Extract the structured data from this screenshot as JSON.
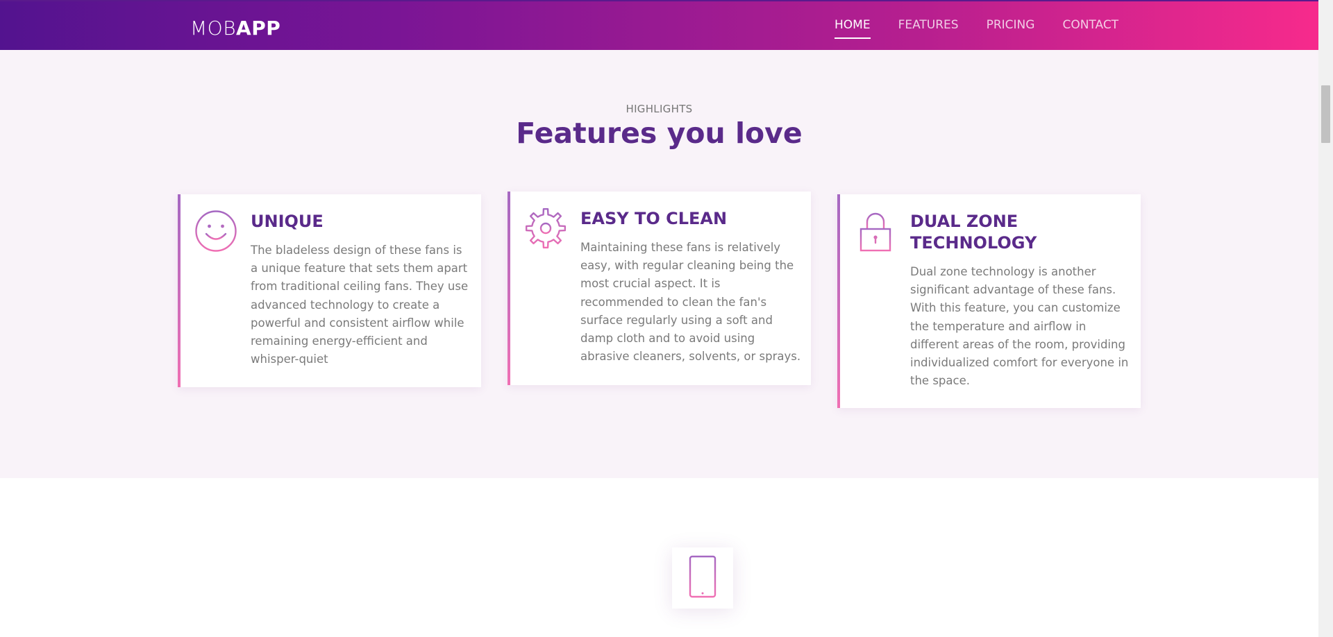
{
  "colors": {
    "nav_gradient_start": "#53138f",
    "nav_gradient_end": "#f72a8c",
    "heading_purple": "#5a2a8a",
    "icon_gradient_start": "#a568c2",
    "icon_gradient_end": "#f06fb3",
    "section_background": "#f9f3f9"
  },
  "header": {
    "logo_light": "MOB",
    "logo_bold": "APP",
    "nav": [
      {
        "label": "HOME",
        "active": true
      },
      {
        "label": "FEATURES",
        "active": false
      },
      {
        "label": "PRICING",
        "active": false
      },
      {
        "label": "CONTACT",
        "active": false
      }
    ]
  },
  "features": {
    "eyebrow": "HIGHLIGHTS",
    "title": "Features you love",
    "cards": [
      {
        "icon": "smile-icon",
        "title": "UNIQUE",
        "text": "The bladeless design of these fans is a unique feature that sets them apart from traditional ceiling fans. They use advanced technology to create a powerful and consistent airflow while remaining energy-efficient and whisper-quiet"
      },
      {
        "icon": "gear-icon",
        "title": "EASY TO CLEAN",
        "text": "Maintaining these fans is relatively easy, with regular cleaning being the most crucial aspect. It is recommended to clean the fan's surface regularly using a soft and damp cloth and to avoid using abrasive cleaners, solvents, or sprays."
      },
      {
        "icon": "lock-icon",
        "title": "DUAL ZONE TECHNOLOGY",
        "text": "Dual zone technology is another significant advantage of these fans. With this feature, you can customize the temperature and airflow in different areas of the room, providing individualized comfort for everyone in the space."
      }
    ]
  },
  "next_section": {
    "icon": "smartphone-icon"
  }
}
